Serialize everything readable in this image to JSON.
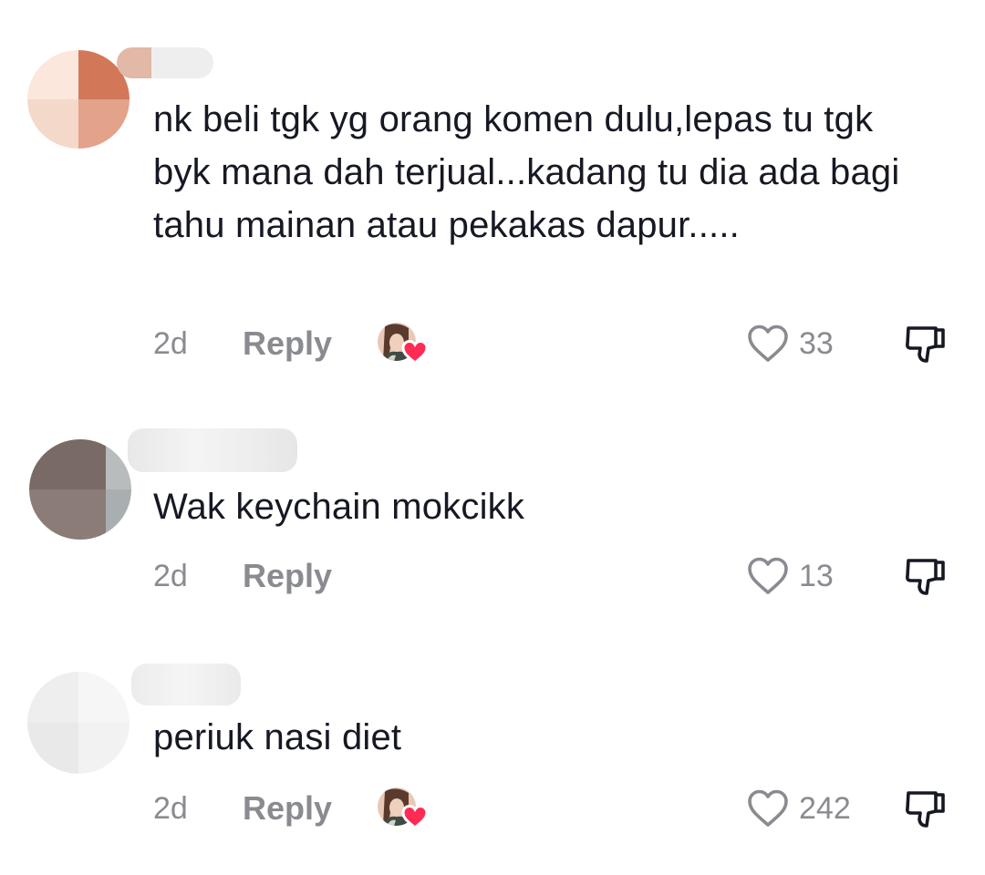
{
  "comments": [
    {
      "text": "nk beli tgk yg orang komen dulu,lepas tu tgk byk mana dah terjual...kadang tu dia ada bagi tahu mainan atau pekakas dapur.....",
      "time": "2d",
      "reply_label": "Reply",
      "likes": "33",
      "liked_by_creator": true
    },
    {
      "text": "Wak keychain mokcikk",
      "time": "2d",
      "reply_label": "Reply",
      "likes": "13",
      "liked_by_creator": false
    },
    {
      "text": "periuk nasi diet",
      "time": "2d",
      "reply_label": "Reply",
      "likes": "242",
      "liked_by_creator": true
    }
  ],
  "icons": {
    "like": "heart-outline-icon",
    "dislike": "thumbs-down-icon",
    "creator_like": "heart-filled-icon"
  },
  "colors": {
    "text": "#161823",
    "secondary": "#8a8b91",
    "heart_accent": "#fe2c55"
  }
}
